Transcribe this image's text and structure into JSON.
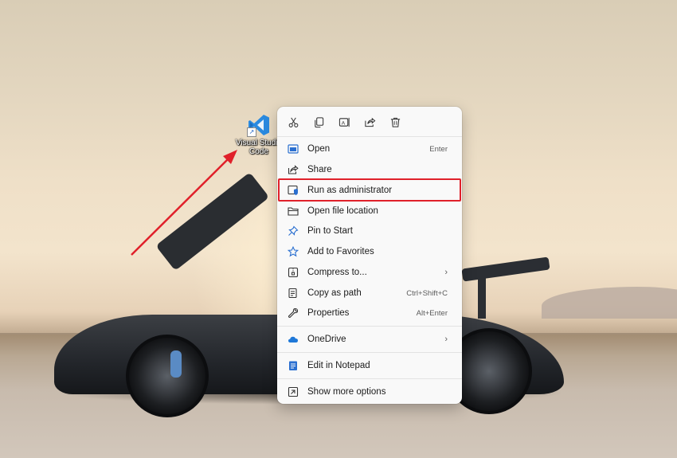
{
  "desktop": {
    "icon": {
      "name": "vscode-shortcut",
      "label": "Visual Studio Code",
      "glyph_color": "#2a8ae0"
    }
  },
  "context_menu": {
    "toolbar": [
      {
        "name": "cut",
        "icon": "scissors-icon"
      },
      {
        "name": "copy",
        "icon": "copy-icon"
      },
      {
        "name": "rename",
        "icon": "rename-icon"
      },
      {
        "name": "share",
        "icon": "share-icon"
      },
      {
        "name": "delete",
        "icon": "trash-icon"
      }
    ],
    "items": [
      {
        "label": "Open",
        "shortcut": "Enter",
        "icon": "app-window-icon"
      },
      {
        "label": "Share",
        "shortcut": "",
        "icon": "share-icon"
      },
      {
        "label": "Run as administrator",
        "shortcut": "",
        "icon": "shield-icon"
      },
      {
        "label": "Open file location",
        "shortcut": "",
        "icon": "folder-icon"
      },
      {
        "label": "Pin to Start",
        "shortcut": "",
        "icon": "pin-icon"
      },
      {
        "label": "Add to Favorites",
        "shortcut": "",
        "icon": "star-icon"
      },
      {
        "label": "Compress to...",
        "shortcut": "",
        "icon": "zip-icon",
        "submenu": true
      },
      {
        "label": "Copy as path",
        "shortcut": "Ctrl+Shift+C",
        "icon": "path-icon"
      },
      {
        "label": "Properties",
        "shortcut": "Alt+Enter",
        "icon": "wrench-icon"
      },
      {
        "label": "OneDrive",
        "shortcut": "",
        "icon": "cloud-icon",
        "submenu": true
      },
      {
        "label": "Edit in Notepad",
        "shortcut": "",
        "icon": "notepad-icon"
      },
      {
        "label": "Show more options",
        "shortcut": "",
        "icon": "more-options-icon"
      }
    ],
    "chevron": "›",
    "highlighted_item": "Run as administrator",
    "colors": {
      "highlight_border": "#e0202a",
      "accent": "#2a6fd0"
    }
  },
  "annotation": {
    "arrow_color": "#e0202a"
  }
}
